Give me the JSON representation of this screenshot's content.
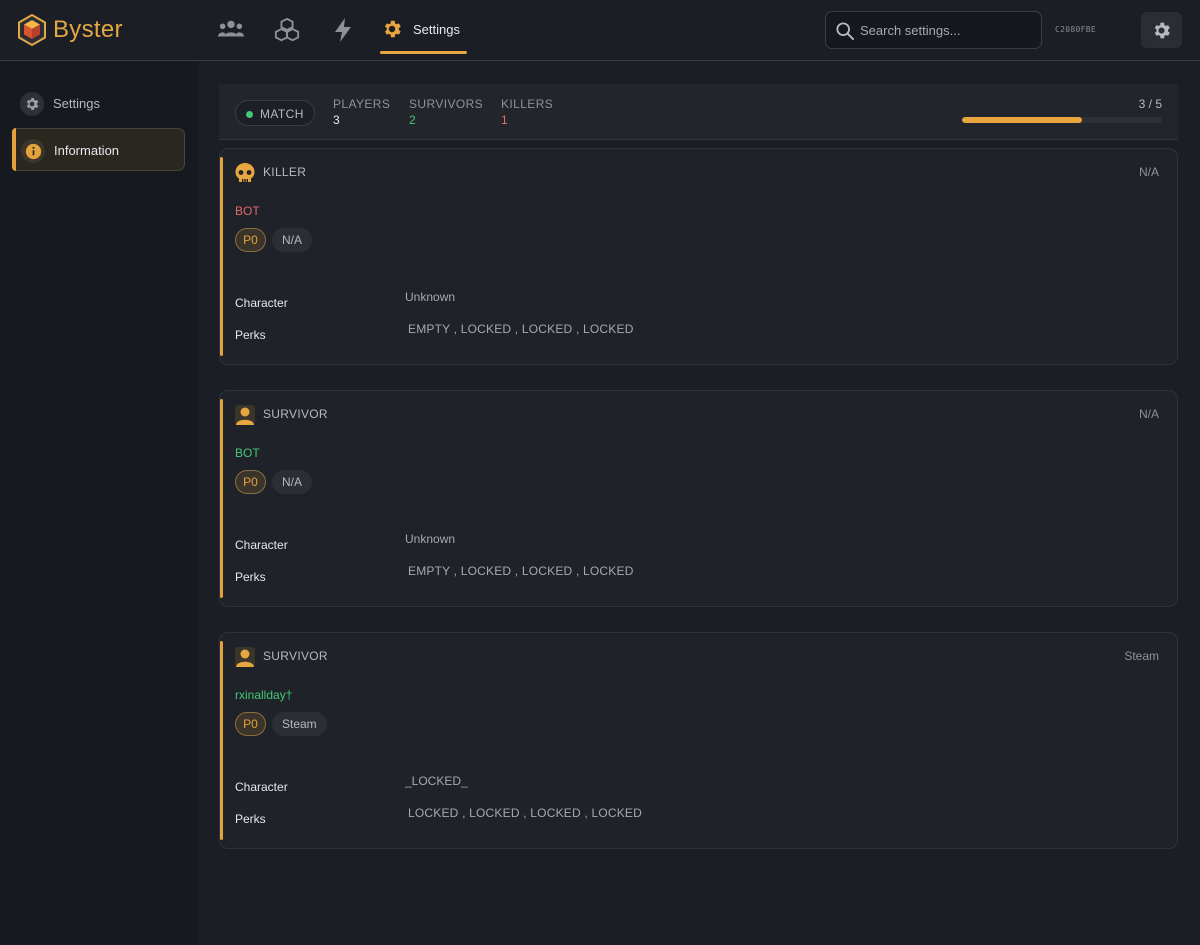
{
  "app": {
    "name": "Byster",
    "hwid": "C2080FBE"
  },
  "nav": {
    "icons": [
      "users-icon",
      "cubes-icon",
      "lightning-icon"
    ],
    "active": {
      "label": "Settings",
      "icon": "gear-icon"
    }
  },
  "search": {
    "placeholder": "Search settings..."
  },
  "sidebar": {
    "items": [
      {
        "label": "Settings",
        "icon": "gear-icon",
        "active": false
      },
      {
        "label": "Information",
        "icon": "info-icon",
        "active": true
      }
    ]
  },
  "stats": {
    "match_label": "MATCH",
    "players": {
      "label": "PLAYERS",
      "value": "3"
    },
    "survivors": {
      "label": "SURVIVORS",
      "value": "2"
    },
    "killers": {
      "label": "KILLERS",
      "value": "1"
    },
    "progress_text": "3 / 5",
    "progress_fraction": 0.6
  },
  "cards": [
    {
      "role": "KILLER",
      "role_icon": "skull-icon",
      "platform": "N/A",
      "name": "BOT",
      "name_color": "#e06a6a",
      "badge": "P0",
      "platform_badge": "N/A",
      "character_label": "Character",
      "character": "Unknown",
      "perks_label": "Perks",
      "perks": "EMPTY ,  LOCKED ,  LOCKED ,  LOCKED"
    },
    {
      "role": "SURVIVOR",
      "role_icon": "person-icon",
      "platform": "N/A",
      "name": "BOT",
      "name_color": "#43c878",
      "badge": "P0",
      "platform_badge": "N/A",
      "character_label": "Character",
      "character": "Unknown",
      "perks_label": "Perks",
      "perks": "EMPTY ,  LOCKED ,  LOCKED ,  LOCKED"
    },
    {
      "role": "SURVIVOR",
      "role_icon": "person-icon",
      "platform": "Steam",
      "name": "rxinallday†",
      "name_color": "#43c878",
      "badge": "P0",
      "platform_badge": "Steam",
      "character_label": "Character",
      "character": "_LOCKED_",
      "perks_label": "Perks",
      "perks": "LOCKED ,  LOCKED ,  LOCKED ,  LOCKED"
    }
  ],
  "colors": {
    "accent": "#e7a640",
    "killer_red": "#e06a6a",
    "survivor_green": "#43c878",
    "background": "#1b1e25"
  }
}
